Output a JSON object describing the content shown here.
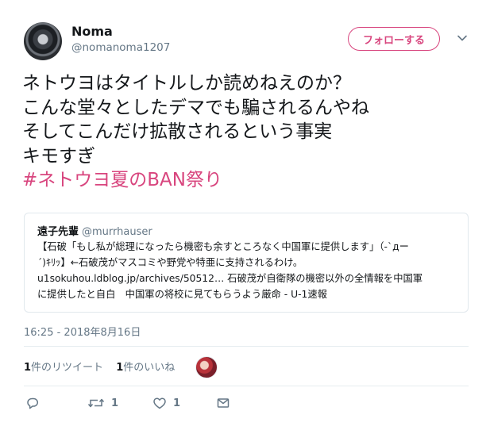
{
  "user": {
    "name": "Noma",
    "handle": "@nomanoma1207"
  },
  "follow_label": "フォローする",
  "tweet": {
    "lines": [
      "ネトウヨはタイトルしか読めねえのか？",
      "こんな堂々としたデマでも騙されるんやね",
      "そしてこんだけ拡散されるという事実",
      "キモすぎ"
    ],
    "hashtag": "#ネトウヨ夏のBAN祭り"
  },
  "quote": {
    "name": "遠子先輩",
    "handle": "@murrhauser",
    "lines": [
      "【石破「もし私が総理になったら機密も余すところなく中国軍に提供します」（-`дー",
      "´)ｷﾘｯ】←石破茂がマスコミや野党や特亜に支持されるわけ。",
      "u1sokuhou.ldblog.jp/archives/50512… 石破茂が自衛隊の機密以外の全情報を中国軍",
      "に提供したと自白　中国軍の将校に見てもらうよう厳命 - U-1速報"
    ]
  },
  "timestamp": "16:25 - 2018年8月16日",
  "stats": {
    "retweets_count": "1",
    "retweets_label": "件のリツイート",
    "likes_count": "1",
    "likes_label": "件のいいね"
  },
  "actions": {
    "reply": {
      "icon": "reply-icon",
      "count": ""
    },
    "retweet": {
      "icon": "retweet-icon",
      "count": "1"
    },
    "like": {
      "icon": "heart-icon",
      "count": "1"
    },
    "dm": {
      "icon": "envelope-icon",
      "count": ""
    }
  },
  "colors": {
    "accent": "#d8457e",
    "muted": "#657786",
    "text": "#14171a",
    "border": "#e1e8ed"
  }
}
